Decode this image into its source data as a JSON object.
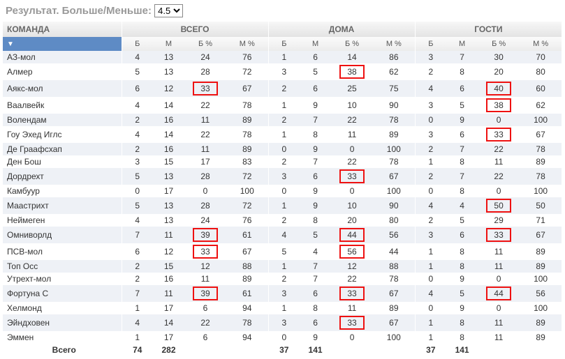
{
  "title": "Результат. Больше/Меньше:",
  "dropdown": {
    "selected": "4.5"
  },
  "headers": {
    "team": "КОМАНДА",
    "groups": [
      "ВСЕГО",
      "ДОМА",
      "ГОСТИ"
    ],
    "cols": [
      "Б",
      "М",
      "Б %",
      "М %"
    ],
    "sort_glyph": "▼"
  },
  "rows": [
    {
      "team": "АЗ-мол",
      "v": [
        4,
        13,
        24,
        76,
        1,
        6,
        14,
        86,
        3,
        7,
        30,
        70
      ],
      "hl": []
    },
    {
      "team": "Алмер",
      "v": [
        5,
        13,
        28,
        72,
        3,
        5,
        38,
        62,
        2,
        8,
        20,
        80
      ],
      "hl": [
        6
      ]
    },
    {
      "team": "Аякс-мол",
      "v": [
        6,
        12,
        33,
        67,
        2,
        6,
        25,
        75,
        4,
        6,
        40,
        60
      ],
      "hl": [
        2,
        10
      ]
    },
    {
      "team": "Ваалвейк",
      "v": [
        4,
        14,
        22,
        78,
        1,
        9,
        10,
        90,
        3,
        5,
        38,
        62
      ],
      "hl": [
        10
      ]
    },
    {
      "team": "Волендам",
      "v": [
        2,
        16,
        11,
        89,
        2,
        7,
        22,
        78,
        0,
        9,
        0,
        100
      ],
      "hl": []
    },
    {
      "team": "Гоу Эхед Иглс",
      "v": [
        4,
        14,
        22,
        78,
        1,
        8,
        11,
        89,
        3,
        6,
        33,
        67
      ],
      "hl": [
        10
      ]
    },
    {
      "team": "Де Граафсхап",
      "v": [
        2,
        16,
        11,
        89,
        0,
        9,
        0,
        100,
        2,
        7,
        22,
        78
      ],
      "hl": []
    },
    {
      "team": "Ден Бош",
      "v": [
        3,
        15,
        17,
        83,
        2,
        7,
        22,
        78,
        1,
        8,
        11,
        89
      ],
      "hl": []
    },
    {
      "team": "Дордрехт",
      "v": [
        5,
        13,
        28,
        72,
        3,
        6,
        33,
        67,
        2,
        7,
        22,
        78
      ],
      "hl": [
        6
      ]
    },
    {
      "team": "Камбуур",
      "v": [
        0,
        17,
        0,
        100,
        0,
        9,
        0,
        100,
        0,
        8,
        0,
        100
      ],
      "hl": []
    },
    {
      "team": "Маастрихт",
      "v": [
        5,
        13,
        28,
        72,
        1,
        9,
        10,
        90,
        4,
        4,
        50,
        50
      ],
      "hl": [
        10
      ]
    },
    {
      "team": "Неймеген",
      "v": [
        4,
        13,
        24,
        76,
        2,
        8,
        20,
        80,
        2,
        5,
        29,
        71
      ],
      "hl": []
    },
    {
      "team": "Омниворлд",
      "v": [
        7,
        11,
        39,
        61,
        4,
        5,
        44,
        56,
        3,
        6,
        33,
        67
      ],
      "hl": [
        2,
        6,
        10
      ]
    },
    {
      "team": "ПСВ-мол",
      "v": [
        6,
        12,
        33,
        67,
        5,
        4,
        56,
        44,
        1,
        8,
        11,
        89
      ],
      "hl": [
        2,
        6
      ]
    },
    {
      "team": "Топ Осс",
      "v": [
        2,
        15,
        12,
        88,
        1,
        7,
        12,
        88,
        1,
        8,
        11,
        89
      ],
      "hl": []
    },
    {
      "team": "Утрехт-мол",
      "v": [
        2,
        16,
        11,
        89,
        2,
        7,
        22,
        78,
        0,
        9,
        0,
        100
      ],
      "hl": []
    },
    {
      "team": "Фортуна С",
      "v": [
        7,
        11,
        39,
        61,
        3,
        6,
        33,
        67,
        4,
        5,
        44,
        56
      ],
      "hl": [
        2,
        6,
        10
      ]
    },
    {
      "team": "Хелмонд",
      "v": [
        1,
        17,
        6,
        94,
        1,
        8,
        11,
        89,
        0,
        9,
        0,
        100
      ],
      "hl": []
    },
    {
      "team": "Эйндховен",
      "v": [
        4,
        14,
        22,
        78,
        3,
        6,
        33,
        67,
        1,
        8,
        11,
        89
      ],
      "hl": [
        6
      ]
    },
    {
      "team": "Эммен",
      "v": [
        1,
        17,
        6,
        94,
        0,
        9,
        0,
        100,
        1,
        8,
        11,
        89
      ],
      "hl": []
    }
  ],
  "total": {
    "label": "Всего",
    "v": [
      74,
      282,
      "",
      "",
      37,
      141,
      "",
      "",
      37,
      141,
      "",
      ""
    ]
  }
}
